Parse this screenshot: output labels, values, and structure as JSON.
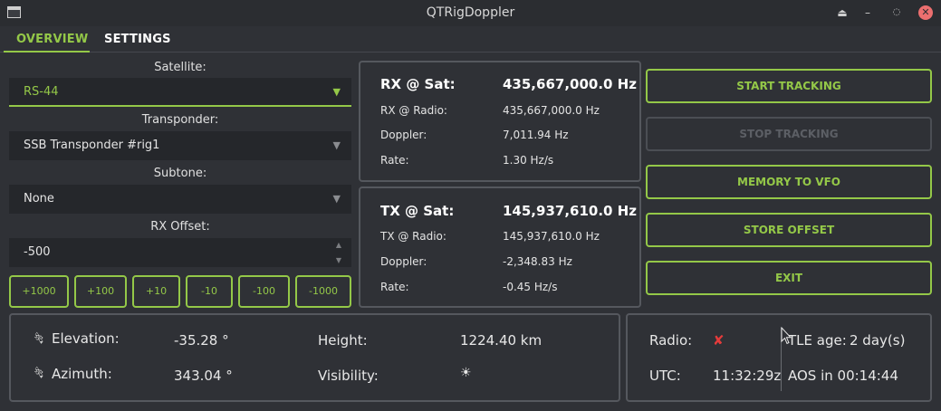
{
  "window": {
    "title": "QTRigDoppler"
  },
  "tabs": [
    {
      "label": "OVERVIEW"
    },
    {
      "label": "SETTINGS"
    }
  ],
  "left": {
    "satellite_label": "Satellite:",
    "satellite_value": "RS-44",
    "transponder_label": "Transponder:",
    "transponder_value": "SSB Transponder #rig1",
    "subtone_label": "Subtone:",
    "subtone_value": "None",
    "rx_offset_label": "RX Offset:",
    "rx_offset_value": "-500",
    "offset_buttons": [
      "+1000",
      "+100",
      "+10",
      "-10",
      "-100",
      "-1000"
    ]
  },
  "rx": {
    "title": "RX @ Sat:",
    "sat_freq": "435,667,000.0 Hz",
    "radio_label": "RX @ Radio:",
    "radio_freq": "435,667,000.0 Hz",
    "doppler_label": "Doppler:",
    "doppler": "7,011.94 Hz",
    "rate_label": "Rate:",
    "rate": "1.30 Hz/s"
  },
  "tx": {
    "title": "TX @ Sat:",
    "sat_freq": "145,937,610.0 Hz",
    "radio_label": "TX @ Radio:",
    "radio_freq": "145,937,610.0 Hz",
    "doppler_label": "Doppler:",
    "doppler": "-2,348.83 Hz",
    "rate_label": "Rate:",
    "rate": "-0.45 Hz/s"
  },
  "buttons": {
    "start": "START TRACKING",
    "stop": "STOP TRACKING",
    "memory": "MEMORY TO VFO",
    "store": "STORE OFFSET",
    "exit": "EXIT"
  },
  "position": {
    "elevation_label": "Elevation:",
    "elevation": "-35.28 °",
    "azimuth_label": "Azimuth:",
    "azimuth": "343.04 °",
    "height_label": "Height:",
    "height": "1224.40 km",
    "visibility_label": "Visibility:",
    "visibility_icon": "☀"
  },
  "status": {
    "radio_label": "Radio:",
    "radio_status": "✘",
    "utc_label": "UTC:",
    "utc": "11:32:29z",
    "tle_label": "TLE age:",
    "tle_age": "2 day(s)",
    "aos": "AOS in 00:14:44"
  },
  "colors": {
    "accent": "#94c848",
    "background": "#2f3136",
    "error": "#e43b3b"
  }
}
